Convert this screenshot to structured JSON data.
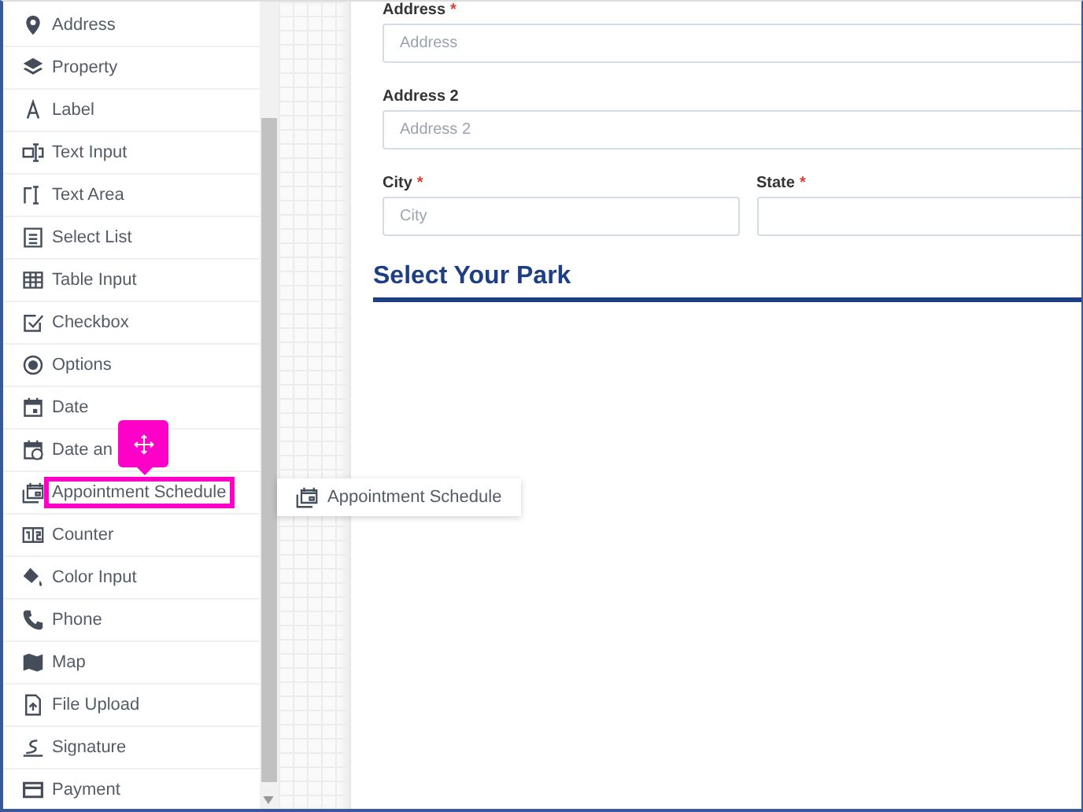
{
  "sidebar": {
    "items": [
      {
        "label": "Address",
        "highlighted": false
      },
      {
        "label": "Property",
        "highlighted": false
      },
      {
        "label": "Label",
        "highlighted": false
      },
      {
        "label": "Text Input",
        "highlighted": false
      },
      {
        "label": "Text Area",
        "highlighted": false
      },
      {
        "label": "Select List",
        "highlighted": false
      },
      {
        "label": "Table Input",
        "highlighted": false
      },
      {
        "label": "Checkbox",
        "highlighted": false
      },
      {
        "label": "Options",
        "highlighted": false
      },
      {
        "label": "Date",
        "highlighted": false
      },
      {
        "label": "Date an",
        "highlighted": false
      },
      {
        "label": "Appointment Schedule",
        "highlighted": true
      },
      {
        "label": "Counter",
        "highlighted": false
      },
      {
        "label": "Color Input",
        "highlighted": false
      },
      {
        "label": "Phone",
        "highlighted": false
      },
      {
        "label": "Map",
        "highlighted": false
      },
      {
        "label": "File Upload",
        "highlighted": false
      },
      {
        "label": "Signature",
        "highlighted": false
      },
      {
        "label": "Payment",
        "highlighted": false
      }
    ]
  },
  "drag_preview": {
    "label": "Appointment Schedule"
  },
  "form": {
    "rows": [
      [
        {
          "label": "Address",
          "required_mark": "*",
          "placeholder": "Address"
        }
      ],
      [
        {
          "label": "Address 2",
          "placeholder": "Address 2"
        }
      ],
      [
        {
          "label": "City",
          "required_mark": "*",
          "placeholder": "City"
        },
        {
          "label": "State",
          "required_mark": "*"
        }
      ]
    ],
    "section_heading": "Select Your Park"
  }
}
